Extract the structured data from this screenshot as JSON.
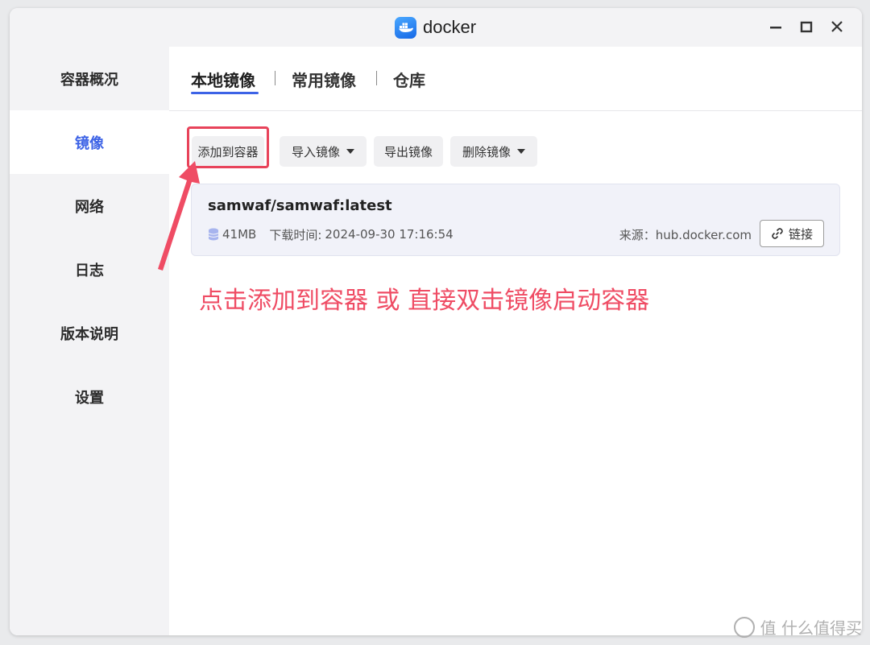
{
  "window": {
    "app_name": "docker"
  },
  "sidebar": {
    "items": [
      {
        "label": "容器概况",
        "active": false
      },
      {
        "label": "镜像",
        "active": true
      },
      {
        "label": "网络",
        "active": false
      },
      {
        "label": "日志",
        "active": false
      },
      {
        "label": "版本说明",
        "active": false
      },
      {
        "label": "设置",
        "active": false
      }
    ]
  },
  "tabs": [
    {
      "label": "本地镜像",
      "active": true
    },
    {
      "label": "常用镜像",
      "active": false
    },
    {
      "label": "仓库",
      "active": false
    }
  ],
  "toolbar": {
    "add_to_container": "添加到容器",
    "import_image": "导入镜像",
    "export_image": "导出镜像",
    "delete_image": "删除镜像"
  },
  "image": {
    "name": "samwaf/samwaf:latest",
    "size": "41MB",
    "download_time_label": "下载时间:",
    "download_time": "2024-09-30 17:16:54",
    "source": "来源：hub.docker.com",
    "link_label": "链接"
  },
  "annotation": "点击添加到容器 或 直接双击镜像启动容器",
  "watermark": "值 什么值得买",
  "colors": {
    "accent": "#3d63e6",
    "annotation": "#ef4c64"
  }
}
